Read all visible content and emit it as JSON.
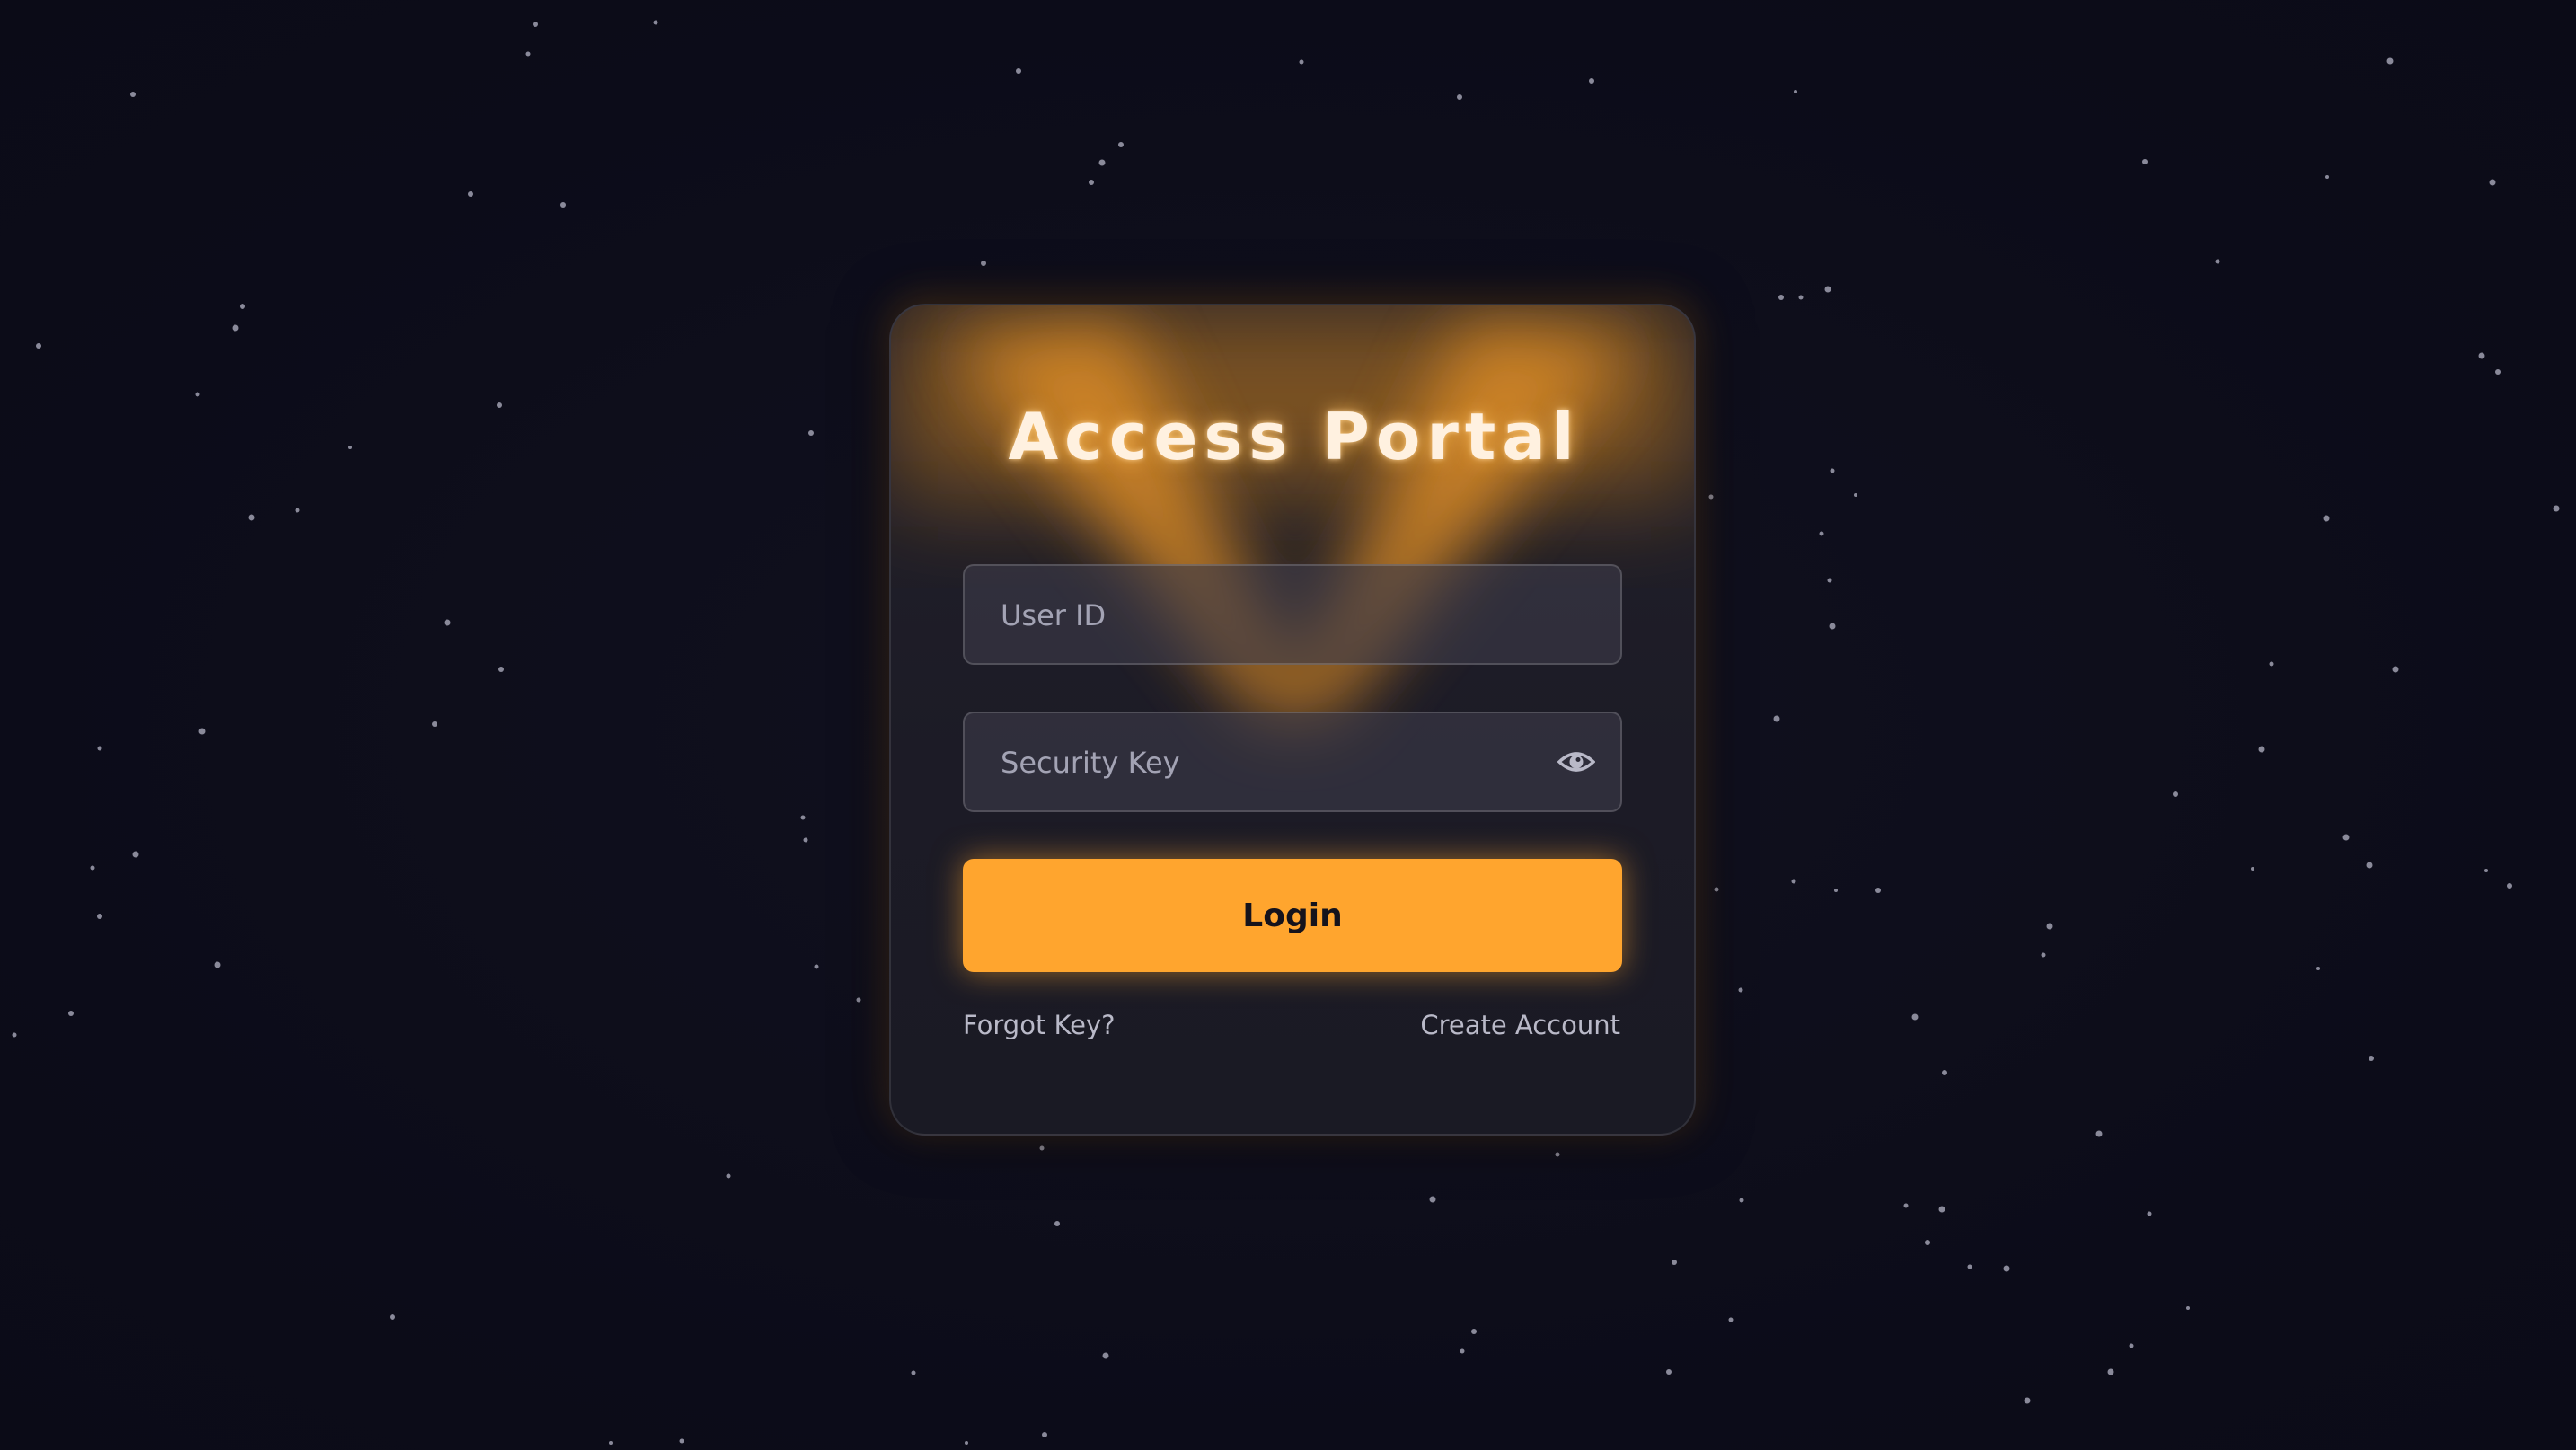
{
  "portal": {
    "title": "Access Portal",
    "user_id_placeholder": "User ID",
    "security_key_placeholder": "Security Key",
    "login_label": "Login",
    "forgot_label": "Forgot Key?",
    "create_label": "Create Account",
    "reveal_icon": "eye-icon"
  },
  "colors": {
    "background": "#0d0d1a",
    "accent": "#ffa52e",
    "card": "#1e1d28",
    "title_text": "#fff1e0",
    "link_text": "#b9b9c8"
  }
}
